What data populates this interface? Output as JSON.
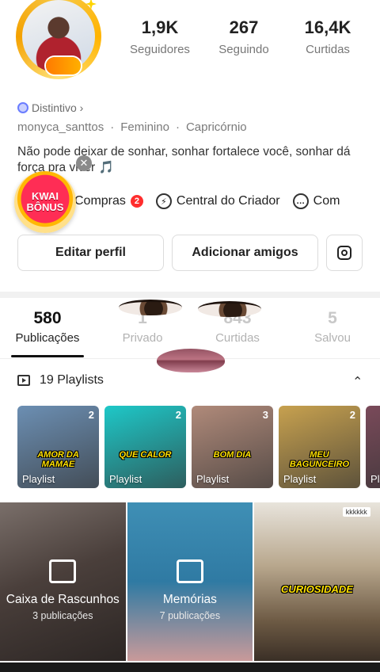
{
  "profile": {
    "stats": [
      {
        "value": "1,9K",
        "label": "Seguidores"
      },
      {
        "value": "267",
        "label": "Seguindo"
      },
      {
        "value": "16,4K",
        "label": "Curtidas"
      }
    ],
    "badge": "Distintivo ›",
    "username": "monyca_santtos",
    "gender": "Feminino",
    "sign": "Capricórnio",
    "separator": "·",
    "bio": "Não pode deixar de sonhar, sonhar fortalece você, sonhar dá força pra viver 🎵"
  },
  "kwai_badge": {
    "line1": "KWAI",
    "line2": "BÔNUS",
    "close": "✕"
  },
  "quick_links": {
    "compras": "Compras",
    "compras_badge": "2",
    "creator": "Central do Criador",
    "comments": "Com"
  },
  "buttons": {
    "edit": "Editar perfil",
    "add_friends": "Adicionar amigos"
  },
  "tabs": [
    {
      "count": "580",
      "label": "Publicações",
      "active": true
    },
    {
      "count": "1",
      "label": "Privado"
    },
    {
      "count": "843",
      "label": "Curtidas"
    },
    {
      "count": "5",
      "label": "Salvou"
    }
  ],
  "playlists": {
    "header": "19 Playlists",
    "items": [
      {
        "count": "2",
        "caption": "AMOR DA MAMAE",
        "label": "Playlist",
        "color": "#6c8fb3"
      },
      {
        "count": "2",
        "caption": "QUE CALOR",
        "label": "Playlist",
        "color": "#1ec8c8"
      },
      {
        "count": "3",
        "caption": "BOM DIA",
        "label": "Playlist",
        "color": "#b08a7a"
      },
      {
        "count": "2",
        "caption": "MEU BAGUNCEIRO",
        "label": "Playlist",
        "color": "#c7a14f"
      },
      {
        "count": "",
        "caption": "",
        "label": "Pl",
        "color": "#7a4a5a"
      }
    ]
  },
  "grid": {
    "drafts": {
      "title": "Caixa de Rascunhos",
      "subtitle": "3 publicações"
    },
    "memories": {
      "title": "Memórias",
      "subtitle": "7 publicações"
    },
    "video": {
      "caption": "CURIOSIDADE",
      "tag": "kkkkkk"
    }
  },
  "colors": {
    "accent_red": "#ff2d2d",
    "active_tab": "#111111",
    "inactive_tab": "#c8c8c8"
  }
}
